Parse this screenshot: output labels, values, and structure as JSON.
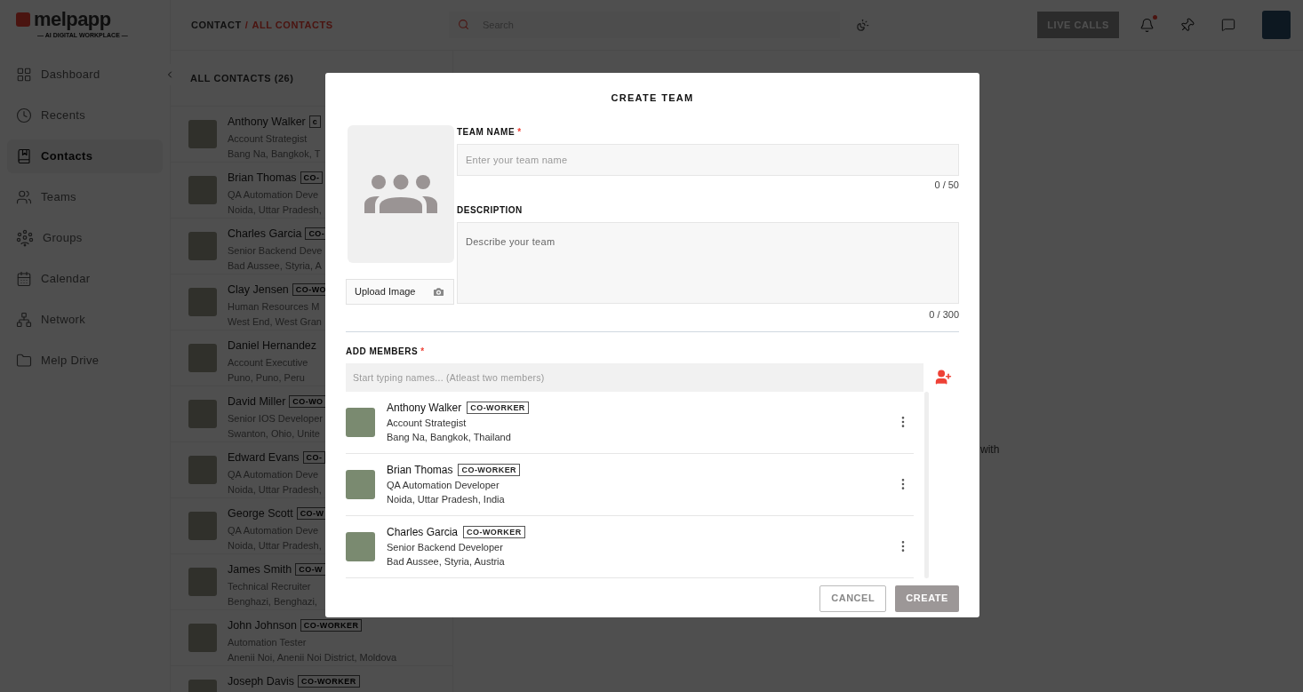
{
  "logo": {
    "name": "melpapp",
    "tagline": "— AI DIGITAL WORKPLACE —"
  },
  "sidebar": {
    "items": [
      {
        "label": "Dashboard",
        "selected": false
      },
      {
        "label": "Recents",
        "selected": false
      },
      {
        "label": "Contacts",
        "selected": true
      },
      {
        "label": "Teams",
        "selected": false
      },
      {
        "label": "Groups",
        "selected": false
      },
      {
        "label": "Calendar",
        "selected": false
      },
      {
        "label": "Network",
        "selected": false
      },
      {
        "label": "Melp Drive",
        "selected": false
      }
    ]
  },
  "breadcrumb": {
    "parent": "CONTACT",
    "separator": "/",
    "current": "ALL CONTACTS"
  },
  "search": {
    "placeholder": "Search"
  },
  "top_actions": {
    "live_calls": "LIVE CALLS",
    "notification_dot": true
  },
  "contacts": {
    "title": "ALL CONTACTS (26)",
    "rows": [
      {
        "name": "Anthony Walker",
        "badge": "c",
        "role": "Account Strategist",
        "location": "Bang Na, Bangkok, T"
      },
      {
        "name": "Brian Thomas",
        "badge": "CO-",
        "role": "QA Automation Deve",
        "location": "Noida, Uttar Pradesh,"
      },
      {
        "name": "Charles Garcia",
        "badge": "CO-",
        "role": "Senior Backend Deve",
        "location": "Bad Aussee, Styria, A"
      },
      {
        "name": "Clay Jensen",
        "badge": "CO-WO",
        "role": "Human Resources M",
        "location": "West End, West Gran"
      },
      {
        "name": "Daniel Hernandez",
        "role": "Account Executive",
        "location": "Puno, Puno, Peru"
      },
      {
        "name": "David Miller",
        "badge": "CO-WO",
        "role": "Senior IOS Developer",
        "location": "Swanton, Ohio, Unite"
      },
      {
        "name": "Edward Evans",
        "badge": "CO-",
        "role": "QA Automation Deve",
        "location": "Noida, Uttar Pradesh,"
      },
      {
        "name": "George Scott",
        "badge": "CO-W",
        "role": "QA Automation Deve",
        "location": "Noida, Uttar Pradesh,"
      },
      {
        "name": "James Smith",
        "badge": "CO-W",
        "role": "Technical Recruiter",
        "location": "Benghazi, Benghazi,"
      },
      {
        "name": "John Johnson",
        "badge": "CO-WORKER",
        "role": "Automation Tester",
        "location": "Anenii Noi, Anenii Noi District, Moldova"
      },
      {
        "name": "Joseph Davis",
        "badge": "CO-WORKER"
      }
    ]
  },
  "background_text": "with",
  "dialog": {
    "title": "CREATE TEAM",
    "upload_button": "Upload Image",
    "team_name": {
      "label": "TEAM NAME",
      "required_mark": "*",
      "placeholder": "Enter your team name",
      "counter": "0 / 50"
    },
    "description": {
      "label": "DESCRIPTION",
      "placeholder": "Describe your team",
      "counter": "0 / 300"
    },
    "members": {
      "label": "ADD MEMBERS",
      "required_mark": "*",
      "placeholder": "Start typing names... (Atleast two members)",
      "items": [
        {
          "name": "Anthony Walker",
          "badge": "CO-WORKER",
          "role": "Account Strategist",
          "location": "Bang Na, Bangkok, Thailand"
        },
        {
          "name": "Brian Thomas",
          "badge": "CO-WORKER",
          "role": "QA Automation Developer",
          "location": "Noida, Uttar Pradesh, India"
        },
        {
          "name": "Charles Garcia",
          "badge": "CO-WORKER",
          "role": "Senior Backend Developer",
          "location": "Bad Aussee, Styria, Austria"
        }
      ]
    },
    "buttons": [
      {
        "label": "CANCEL",
        "kind": "secondary"
      },
      {
        "label": "CREATE",
        "kind": "primary"
      }
    ]
  }
}
